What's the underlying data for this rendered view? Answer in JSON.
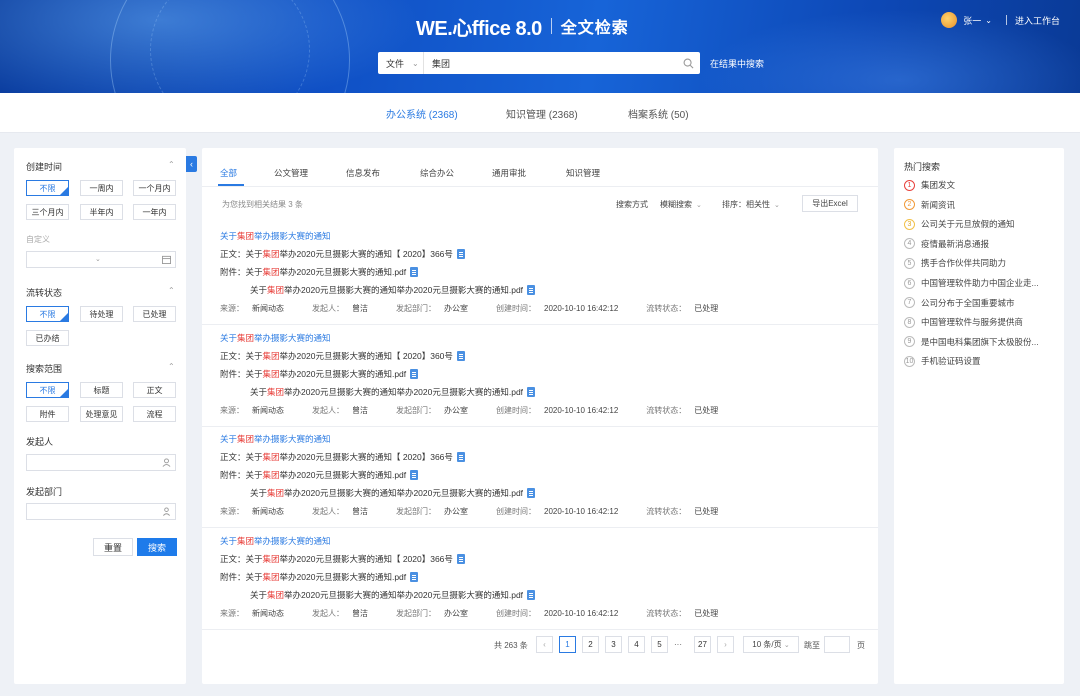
{
  "header": {
    "brand": "WE.心ffice 8.0",
    "module_title": "全文检索",
    "user_name": "张一",
    "enter_workbench": "进入工作台",
    "scope_label": "文件",
    "search_value": "集团",
    "sub_search": "在结果中搜索"
  },
  "system_tabs": [
    {
      "label": "办公系统 (2368)"
    },
    {
      "label": "知识管理 (2368)"
    },
    {
      "label": "档案系统 (50)"
    }
  ],
  "filters": {
    "time_title": "创建时间",
    "time_chips": [
      "不限",
      "一周内",
      "一个月内",
      "三个月内",
      "半年内",
      "一年内"
    ],
    "custom_label": "自定义",
    "status_title": "流转状态",
    "status_chips": [
      "不限",
      "待处理",
      "已处理",
      "已办结"
    ],
    "scope_title": "搜索范围",
    "scope_chips": [
      "不限",
      "标题",
      "正文",
      "附件",
      "处理意见",
      "流程"
    ],
    "initiator_title": "发起人",
    "dept_title": "发起部门",
    "reset_label": "重置",
    "search_label": "搜索"
  },
  "content": {
    "tabs": [
      "全部",
      "公文管理",
      "信息发布",
      "综合办公",
      "通用审批",
      "知识管理"
    ],
    "found_text": "为您找到相关结果 3 条",
    "search_mode_label": "搜索方式",
    "search_mode_value": "模糊搜索",
    "sort_label": "排序：相关性",
    "export_label": "导出Excel",
    "results": [
      {
        "title_pre": "关于",
        "title_hl": "集团",
        "title_post": "举办摄影大赛的通知",
        "body_label": "正文：",
        "body_pre": "关于",
        "body_hl": "集团",
        "body_post": "举办2020元旦摄影大赛的通知【 2020】366号",
        "att_label": "附件：",
        "att1_pre": "关于",
        "att1_hl": "集团",
        "att1_post": "举办2020元旦摄影大赛的通知.pdf",
        "att2_pre": "关于",
        "att2_hl": "集团",
        "att2_post": "举办2020元旦摄影大赛的通知举办2020元旦摄影大赛的通知.pdf",
        "src_k": "来源：",
        "src_v": "新闻动态",
        "initiator_k": "发起人：",
        "initiator_v": "曾洁",
        "dept_k": "发起部门：",
        "dept_v": "办公室",
        "time_k": "创建时间：",
        "time_v": "2020-10-10 16:42:12",
        "status_k": "流转状态：",
        "status_v": "已处理"
      },
      {
        "title_pre": "关于",
        "title_hl": "集团",
        "title_post": "举办摄影大赛的通知",
        "body_label": "正文：",
        "body_pre": "关于",
        "body_hl": "集团",
        "body_post": "举办2020元旦摄影大赛的通知【 2020】360号",
        "att_label": "附件：",
        "att1_pre": "关于",
        "att1_hl": "集团",
        "att1_post": "举办2020元旦摄影大赛的通知.pdf",
        "att2_pre": "关于",
        "att2_hl": "集团",
        "att2_post": "举办2020元旦摄影大赛的通知举办2020元旦摄影大赛的通知.pdf",
        "src_k": "来源：",
        "src_v": "新闻动态",
        "initiator_k": "发起人：",
        "initiator_v": "曾洁",
        "dept_k": "发起部门：",
        "dept_v": "办公室",
        "time_k": "创建时间：",
        "time_v": "2020-10-10 16:42:12",
        "status_k": "流转状态：",
        "status_v": "已处理"
      },
      {
        "title_pre": "关于",
        "title_hl": "集团",
        "title_post": "举办摄影大赛的通知",
        "body_label": "正文：",
        "body_pre": "关于",
        "body_hl": "集团",
        "body_post": "举办2020元旦摄影大赛的通知【 2020】366号",
        "att_label": "附件：",
        "att1_pre": "关于",
        "att1_hl": "集团",
        "att1_post": "举办2020元旦摄影大赛的通知.pdf",
        "att2_pre": "关于",
        "att2_hl": "集团",
        "att2_post": "举办2020元旦摄影大赛的通知举办2020元旦摄影大赛的通知.pdf",
        "src_k": "来源：",
        "src_v": "新闻动态",
        "initiator_k": "发起人：",
        "initiator_v": "曾洁",
        "dept_k": "发起部门：",
        "dept_v": "办公室",
        "time_k": "创建时间：",
        "time_v": "2020-10-10 16:42:12",
        "status_k": "流转状态：",
        "status_v": "已处理"
      },
      {
        "title_pre": "关于",
        "title_hl": "集团",
        "title_post": "举办摄影大赛的通知",
        "body_label": "正文：",
        "body_pre": "关于",
        "body_hl": "集团",
        "body_post": "举办2020元旦摄影大赛的通知【 2020】366号",
        "att_label": "附件：",
        "att1_pre": "关于",
        "att1_hl": "集团",
        "att1_post": "举办2020元旦摄影大赛的通知.pdf",
        "att2_pre": "关于",
        "att2_hl": "集团",
        "att2_post": "举办2020元旦摄影大赛的通知举办2020元旦摄影大赛的通知.pdf",
        "src_k": "来源：",
        "src_v": "新闻动态",
        "initiator_k": "发起人：",
        "initiator_v": "曾洁",
        "dept_k": "发起部门：",
        "dept_v": "办公室",
        "time_k": "创建时间：",
        "time_v": "2020-10-10 16:42:12",
        "status_k": "流转状态：",
        "status_v": "已处理"
      }
    ],
    "pager": {
      "total": "共 263 条",
      "pages": [
        "1",
        "2",
        "3",
        "4",
        "5"
      ],
      "ellipsis": "···",
      "last": "27",
      "page_size": "10 条/页",
      "jump_label": "跳至",
      "page_unit": "页"
    }
  },
  "hot": {
    "title": "热门搜索",
    "items": [
      "集团发文",
      "新闻资讯",
      "公司关于元旦放假的通知",
      "疫情最新消息通报",
      "携手合作伙伴共同助力",
      "中国管理软件助力中国企业走...",
      "公司分布于全国重要城市",
      "中国管理软件与服务提供商",
      "是中国电科集团旗下太极股份...",
      "手机验证码设置"
    ]
  },
  "colors": {
    "accent": "#2a7ae2",
    "highlight": "#e8413c",
    "header": "#0f4fc4"
  }
}
